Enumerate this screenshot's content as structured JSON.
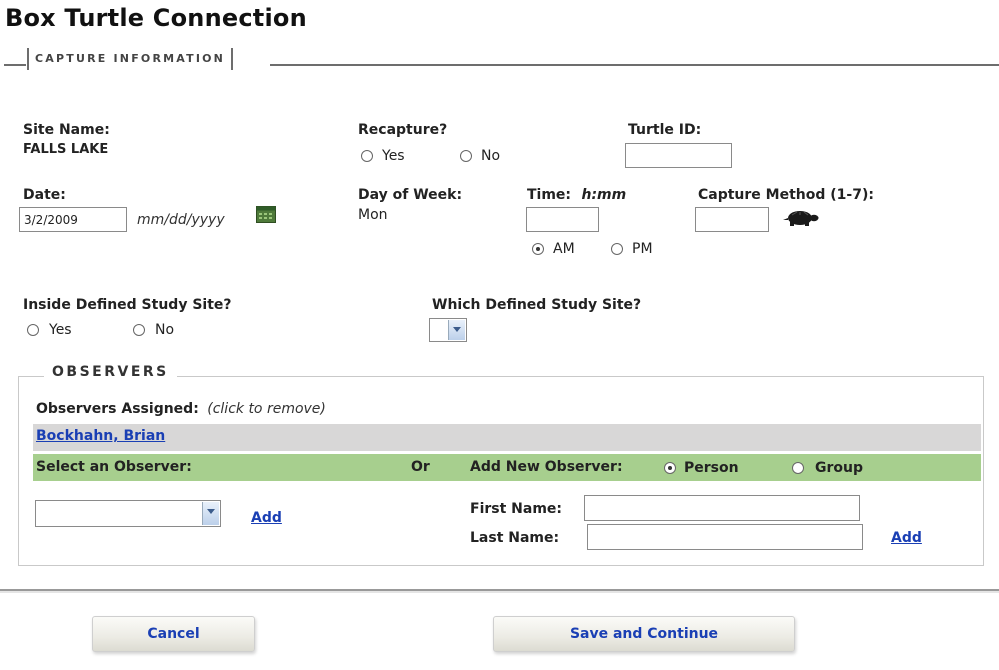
{
  "app": {
    "title": "Box Turtle Connection"
  },
  "section": {
    "legend": "CAPTURE INFORMATION"
  },
  "site": {
    "label": "Site Name:",
    "value": "FALLS LAKE"
  },
  "recapture": {
    "label": "Recapture?",
    "options": [
      {
        "label": "Yes",
        "checked": false
      },
      {
        "label": "No",
        "checked": false
      }
    ]
  },
  "turtle": {
    "label": "Turtle ID:",
    "value": ""
  },
  "date": {
    "label": "Date:",
    "value": "3/2/2009",
    "format_hint": "mm/dd/yyyy",
    "icon": "calendar-icon"
  },
  "day_of_week": {
    "label": "Day of Week:",
    "value": "Mon"
  },
  "time": {
    "label": "Time:",
    "format_hint": "h:mm",
    "value": "",
    "options": [
      {
        "label": "AM",
        "checked": true
      },
      {
        "label": "PM",
        "checked": false
      }
    ]
  },
  "capture_method": {
    "label": "Capture Method (1-7):",
    "value": "",
    "icon": "turtle-icon"
  },
  "inside_site": {
    "label": "Inside Defined Study Site?",
    "options": [
      {
        "label": "Yes",
        "checked": false
      },
      {
        "label": "No",
        "checked": false
      }
    ]
  },
  "which_site": {
    "label": "Which Defined Study Site?",
    "value": ""
  },
  "observers": {
    "legend": "OBSERVERS",
    "assigned_label": "Observers Assigned:",
    "assigned_hint": "(click to remove)",
    "assigned": [
      "Bockhahn, Brian"
    ],
    "select_label": "Select an Observer:",
    "or_label": "Or",
    "add_new_label": "Add New Observer:",
    "type_options": [
      {
        "label": "Person",
        "checked": true
      },
      {
        "label": "Group",
        "checked": false
      }
    ],
    "select_value": "",
    "add_link": "Add",
    "first_name_label": "First Name:",
    "first_name_value": "",
    "last_name_label": "Last Name:",
    "last_name_value": "",
    "add_new_link": "Add"
  },
  "actions": {
    "cancel": "Cancel",
    "save": "Save and Continue"
  },
  "colors": {
    "link": "#1a3fb4",
    "green_bar": "#a7cf8e",
    "grey_bar": "#d8d7d7"
  }
}
